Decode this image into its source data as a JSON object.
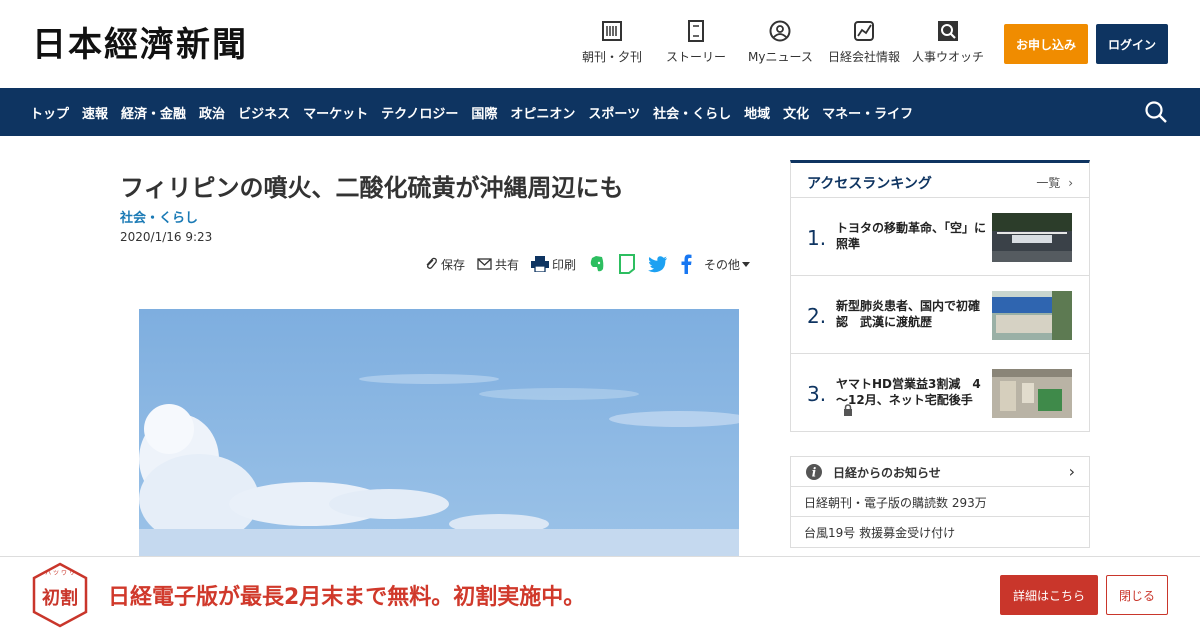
{
  "header": {
    "logo": "日本經濟新聞",
    "nav": [
      {
        "label": "朝刊・夕刊",
        "icon": "newspaper-icon"
      },
      {
        "label": "ストーリー",
        "icon": "document-icon"
      },
      {
        "label": "Myニュース",
        "icon": "user-icon"
      },
      {
        "label": "日経会社情報",
        "icon": "chart-icon"
      },
      {
        "label": "人事ウオッチ",
        "icon": "search-person-icon"
      }
    ],
    "apply_label": "お申し込み",
    "login_label": "ログイン"
  },
  "navbar": {
    "items": [
      "トップ",
      "速報",
      "経済・金融",
      "政治",
      "ビジネス",
      "マーケット",
      "テクノロジー",
      "国際",
      "オピニオン",
      "スポーツ",
      "社会・くらし",
      "地域",
      "文化",
      "マネー・ライフ"
    ],
    "search_icon": "search-icon"
  },
  "article": {
    "title": "フィリピンの噴火、二酸化硫黄が沖縄周辺にも",
    "category": "社会・くらし",
    "date": "2020/1/16 9:23",
    "tools": {
      "save": "保存",
      "share": "共有",
      "print": "印刷",
      "more": "その他"
    }
  },
  "ranking": {
    "title": "アクセスランキング",
    "all_label": "一覧",
    "items": [
      {
        "rank": "1.",
        "text": "トヨタの移動革命、「空」に照準"
      },
      {
        "rank": "2.",
        "text": "新型肺炎患者、国内で初確認　武漢に渡航歴"
      },
      {
        "rank": "3.",
        "text": "ヤマトHD営業益3割減　4～12月、ネット宅配後手"
      }
    ]
  },
  "notice": {
    "title": "日経からのお知らせ",
    "items": [
      "日経朝刊・電子版の購読数 293万",
      "台風19号 救援募金受け付け"
    ]
  },
  "banner": {
    "badge": "初割",
    "badge_ruby": "ハ ツ ワ リ",
    "text": "日経電子版が最長2月末まで無料。初割実施中。",
    "detail_label": "詳細はこちら",
    "close_label": "閉じる"
  }
}
